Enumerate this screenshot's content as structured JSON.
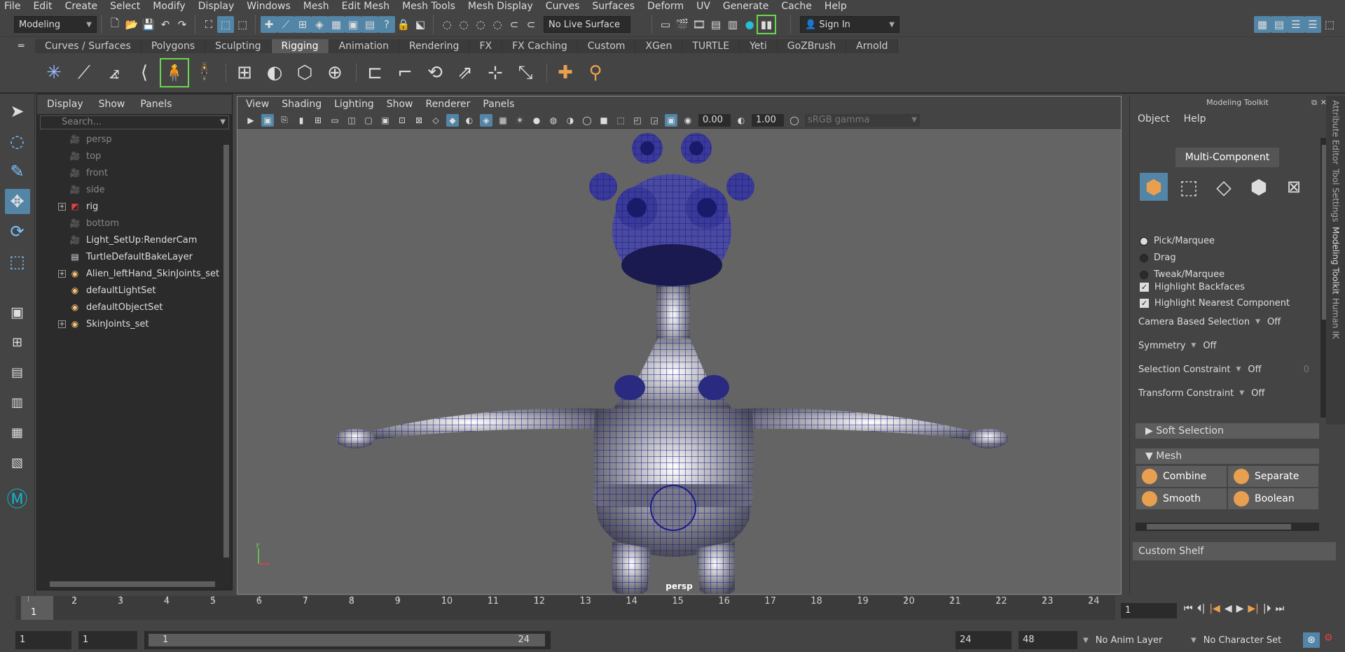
{
  "menubar": [
    "File",
    "Edit",
    "Create",
    "Select",
    "Modify",
    "Display",
    "Windows",
    "Mesh",
    "Edit Mesh",
    "Mesh Tools",
    "Mesh Display",
    "Curves",
    "Surfaces",
    "Deform",
    "UV",
    "Generate",
    "Cache",
    "Help"
  ],
  "statusline": {
    "workspace": "Modeling",
    "live_surface": "No Live Surface",
    "sign_in": "Sign In"
  },
  "shelf_tabs": [
    "Curves / Surfaces",
    "Polygons",
    "Sculpting",
    "Rigging",
    "Animation",
    "Rendering",
    "FX",
    "FX Caching",
    "Custom",
    "XGen",
    "TURTLE",
    "Yeti",
    "GoZBrush",
    "Arnold"
  ],
  "active_shelf_tab": "Rigging",
  "outliner": {
    "menu": [
      "Display",
      "Show",
      "Panels"
    ],
    "search_placeholder": "Search...",
    "items": [
      {
        "label": "persp",
        "dim": true,
        "expand": false,
        "icon": "camera-icon"
      },
      {
        "label": "top",
        "dim": true,
        "expand": false,
        "icon": "camera-icon"
      },
      {
        "label": "front",
        "dim": true,
        "expand": false,
        "icon": "camera-icon"
      },
      {
        "label": "side",
        "dim": true,
        "expand": false,
        "icon": "camera-icon"
      },
      {
        "label": "rig",
        "dim": false,
        "expand": true,
        "icon": "transform-icon"
      },
      {
        "label": "bottom",
        "dim": true,
        "expand": false,
        "icon": "camera-icon"
      },
      {
        "label": "Light_SetUp:RenderCam",
        "dim": false,
        "expand": false,
        "icon": "camera-icon"
      },
      {
        "label": "TurtleDefaultBakeLayer",
        "dim": false,
        "expand": false,
        "icon": "layer-icon"
      },
      {
        "label": "Alien_leftHand_SkinJoints_set",
        "dim": false,
        "expand": true,
        "icon": "set-icon"
      },
      {
        "label": "defaultLightSet",
        "dim": false,
        "expand": false,
        "icon": "set-icon"
      },
      {
        "label": "defaultObjectSet",
        "dim": false,
        "expand": false,
        "icon": "set-icon"
      },
      {
        "label": "SkinJoints_set",
        "dim": false,
        "expand": true,
        "icon": "set-icon"
      }
    ]
  },
  "viewport": {
    "menu": [
      "View",
      "Shading",
      "Lighting",
      "Show",
      "Renderer",
      "Panels"
    ],
    "exposure": "0.00",
    "gamma": "1.00",
    "color_space": "sRGB gamma",
    "camera_label": "persp",
    "axis_y": "y"
  },
  "modeling_toolkit": {
    "title": "Modeling Toolkit",
    "menu": [
      "Object",
      "Help"
    ],
    "mode": "Multi-Component",
    "pick_modes": [
      {
        "label": "Pick/Marquee",
        "on": true
      },
      {
        "label": "Drag",
        "on": false
      },
      {
        "label": "Tweak/Marquee",
        "on": false
      }
    ],
    "checks": [
      "Highlight Backfaces",
      "Highlight Nearest Component"
    ],
    "options": [
      {
        "label": "Camera Based Selection",
        "value": "Off"
      },
      {
        "label": "Symmetry",
        "value": "Off"
      },
      {
        "label": "Selection Constraint",
        "value": "Off",
        "extra": "0"
      },
      {
        "label": "Transform Constraint",
        "value": "Off"
      }
    ],
    "soft_selection": "Soft Selection",
    "mesh_section": "Mesh",
    "mesh_buttons": [
      {
        "label": "Combine",
        "color": "#e8a050"
      },
      {
        "label": "Separate",
        "color": "#e8a050"
      },
      {
        "label": "Smooth",
        "color": "#e8a050"
      },
      {
        "label": "Boolean",
        "color": "#e8a050"
      }
    ],
    "custom_shelf": "Custom Shelf"
  },
  "side_tabs": [
    "Attribute Editor",
    "Tool Settings",
    "Modeling Toolkit",
    "Human IK"
  ],
  "timeline": {
    "ticks": [
      "1",
      "2",
      "3",
      "4",
      "5",
      "6",
      "7",
      "8",
      "9",
      "10",
      "11",
      "12",
      "13",
      "14",
      "15",
      "16",
      "17",
      "18",
      "19",
      "20",
      "21",
      "22",
      "23",
      "24"
    ],
    "current_frame_marker": "1",
    "current_frame": "1"
  },
  "range": {
    "start": "1",
    "playback_start": "1",
    "slider_start": "1",
    "slider_end": "24",
    "end": "24",
    "anim_end": "48",
    "anim_layer": "No Anim Layer",
    "character_set": "No Character Set"
  }
}
